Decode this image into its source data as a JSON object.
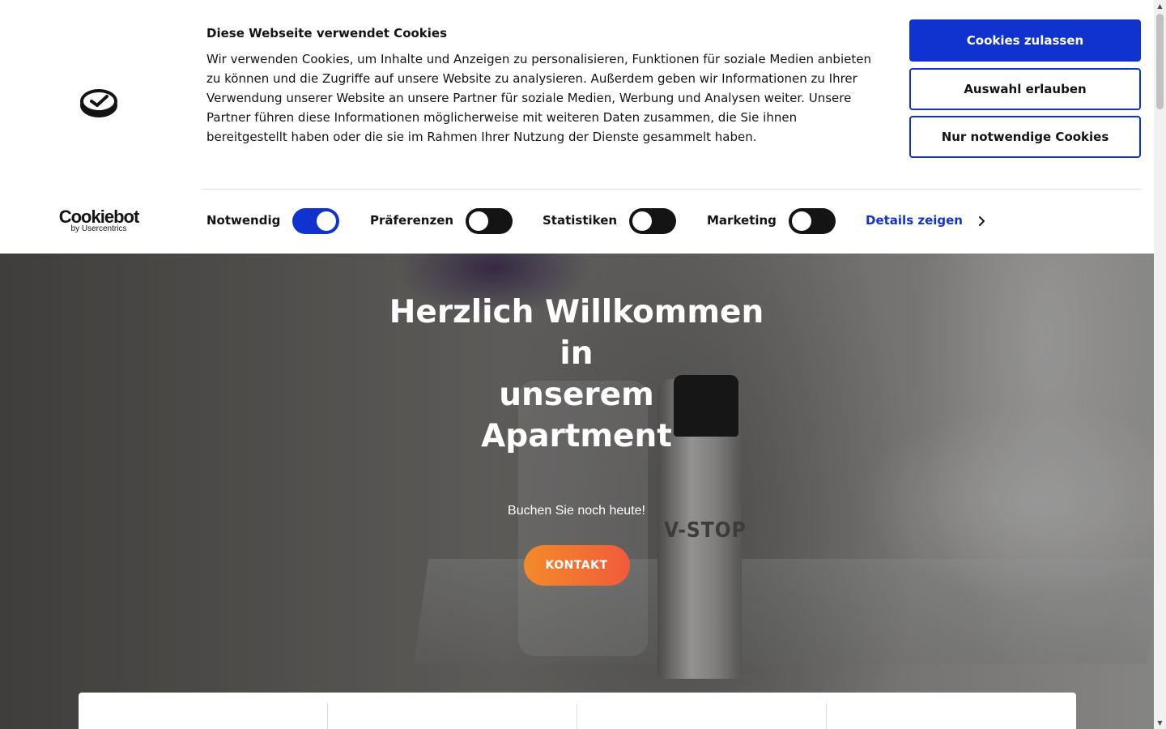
{
  "cookie_banner": {
    "brand": {
      "name": "Cookiebot",
      "by": "by Usercentrics"
    },
    "heading": "Diese Webseite verwendet Cookies",
    "body": "Wir verwenden Cookies, um Inhalte und Anzeigen zu personalisieren, Funktionen für soziale Medien anbieten zu können und die Zugriffe auf unsere Website zu analysieren. Außerdem geben wir Informationen zu Ihrer Verwendung unserer Website an unsere Partner für soziale Medien, Werbung und Analysen weiter. Unsere Partner führen diese Informationen möglicherweise mit weiteren Daten zusammen, die Sie ihnen bereitgestellt haben oder die sie im Rahmen Ihrer Nutzung der Dienste gesammelt haben.",
    "buttons": {
      "allow_all": "Cookies zulassen",
      "allow_selection": "Auswahl erlauben",
      "necessary_only": "Nur notwendige Cookies"
    },
    "consent": [
      {
        "label": "Notwendig",
        "enabled": true
      },
      {
        "label": "Präferenzen",
        "enabled": false
      },
      {
        "label": "Statistiken",
        "enabled": false
      },
      {
        "label": "Marketing",
        "enabled": false
      }
    ],
    "details_link": "Details zeigen",
    "colors": {
      "accent": "#1032cf",
      "toggle_off": "#141414",
      "text": "#141414"
    }
  },
  "hero": {
    "title_lines": [
      "Herzlich Willkommen in",
      "unserem",
      "Apartment"
    ],
    "subtitle": "Buchen Sie noch heute!",
    "cta": "KONTAKT",
    "bottle_text": "V-STOP",
    "colors": {
      "cta_start": "#f38a2a",
      "cta_end": "#f25b3a"
    }
  },
  "icons": [
    "cookie-consent-icon",
    "chevron-right-icon",
    "scroll-up-icon",
    "scroll-down-icon"
  ]
}
